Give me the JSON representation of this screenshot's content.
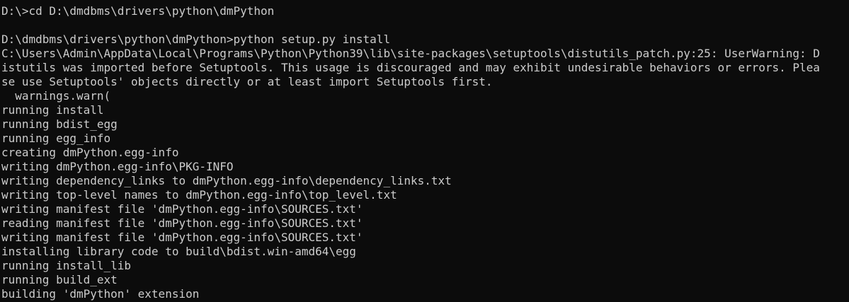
{
  "terminal": {
    "lines": [
      "D:\\>cd D:\\dmdbms\\drivers\\python\\dmPython",
      "",
      "D:\\dmdbms\\drivers\\python\\dmPython>python setup.py install",
      "C:\\Users\\Admin\\AppData\\Local\\Programs\\Python\\Python39\\lib\\site-packages\\setuptools\\distutils_patch.py:25: UserWarning: D",
      "istutils was imported before Setuptools. This usage is discouraged and may exhibit undesirable behaviors or errors. Plea",
      "se use Setuptools' objects directly or at least import Setuptools first.",
      "  warnings.warn(",
      "running install",
      "running bdist_egg",
      "running egg_info",
      "creating dmPython.egg-info",
      "writing dmPython.egg-info\\PKG-INFO",
      "writing dependency_links to dmPython.egg-info\\dependency_links.txt",
      "writing top-level names to dmPython.egg-info\\top_level.txt",
      "writing manifest file 'dmPython.egg-info\\SOURCES.txt'",
      "reading manifest file 'dmPython.egg-info\\SOURCES.txt'",
      "writing manifest file 'dmPython.egg-info\\SOURCES.txt'",
      "installing library code to build\\bdist.win-amd64\\egg",
      "running install_lib",
      "running build_ext",
      "building 'dmPython' extension"
    ]
  }
}
